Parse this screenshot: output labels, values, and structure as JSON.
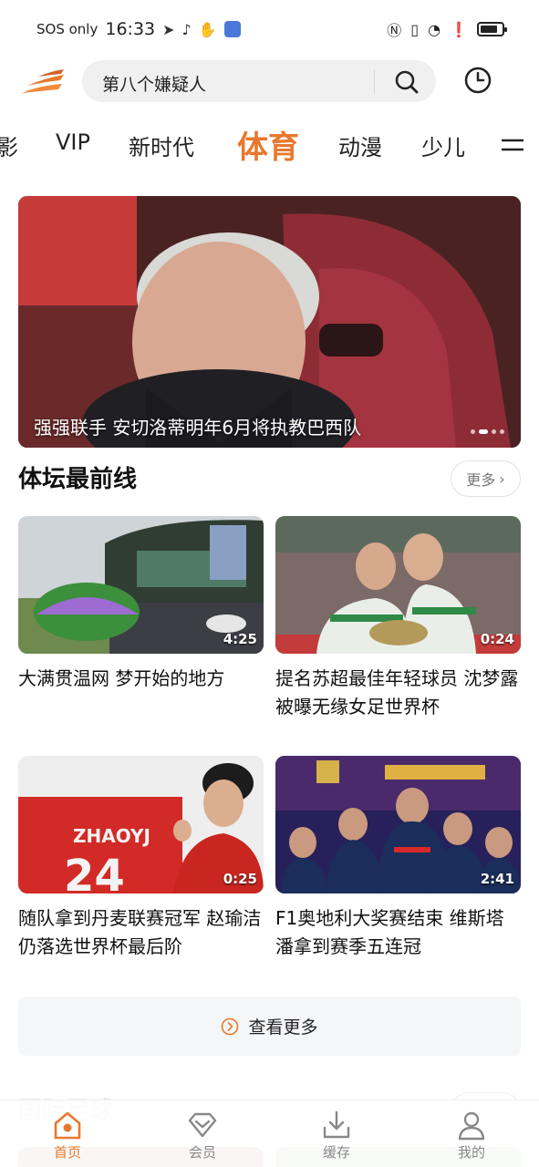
{
  "status_bar": {
    "carrier": "SOS only",
    "time": "16:33"
  },
  "search": {
    "query": "第八个嫌疑人"
  },
  "tabs": [
    {
      "label": "影"
    },
    {
      "label": "VIP"
    },
    {
      "label": "新时代"
    },
    {
      "label": "体育",
      "active": true
    },
    {
      "label": "动漫"
    },
    {
      "label": "少儿"
    }
  ],
  "banner": {
    "caption": "强强联手 安切洛蒂明年6月将执教巴西队",
    "slide_count": 4,
    "active_slide": 2
  },
  "section": {
    "title": "体坛最前线",
    "more_label": "更多"
  },
  "cards": [
    {
      "title": "大满贯温网 梦开始的地方",
      "duration": "4:25"
    },
    {
      "title": "提名苏超最佳年轻球员 沈梦露被曝无缘女足世界杯",
      "duration": "0:24"
    },
    {
      "title": "随队拿到丹麦联赛冠军 赵瑜洁仍落选世界杯最后阶",
      "duration": "0:25",
      "jersey_text": "ZHAOYJ",
      "jersey_number": "24"
    },
    {
      "title": "F1奥地利大奖赛结束 维斯塔潘拿到赛季五连冠",
      "duration": "2:41"
    }
  ],
  "view_more": {
    "label": "查看更多"
  },
  "next_section": {
    "title": "国际足球"
  },
  "bottom_nav": [
    {
      "label": "首页",
      "icon": "home-icon",
      "active": true
    },
    {
      "label": "会员",
      "icon": "vip-diamond-icon"
    },
    {
      "label": "缓存",
      "icon": "download-icon"
    },
    {
      "label": "我的",
      "icon": "profile-icon"
    }
  ],
  "colors": {
    "accent": "#e8782d",
    "text": "#111111",
    "muted": "#888888"
  }
}
